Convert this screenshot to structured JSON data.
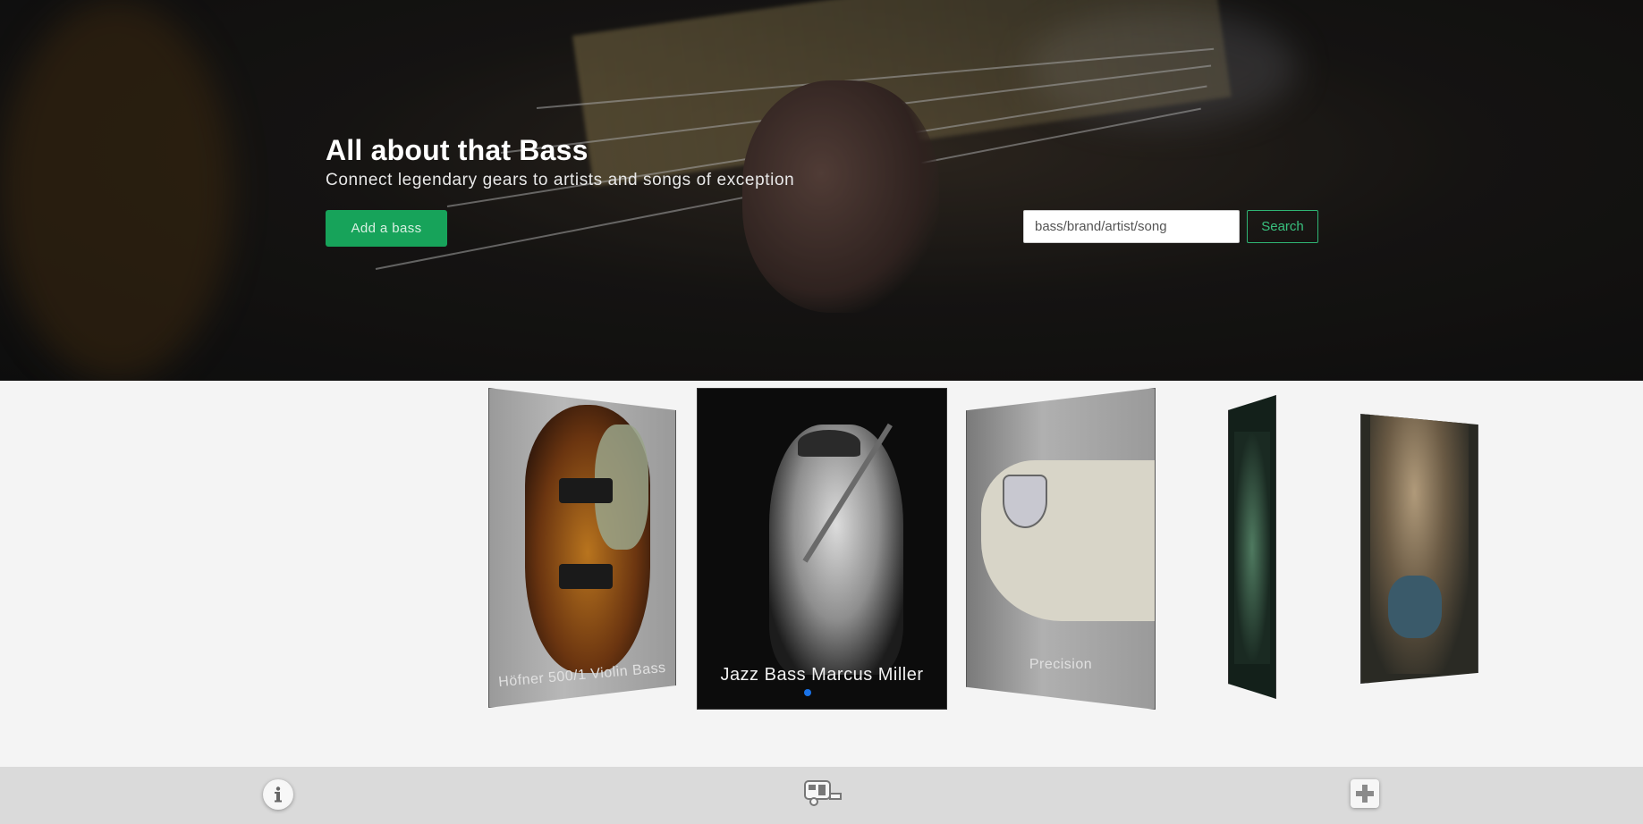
{
  "hero": {
    "title": "All about that Bass",
    "subtitle": "Connect legendary gears to artists and songs of exception",
    "add_button_label": "Add a bass",
    "search_placeholder": "bass/brand/artist/song",
    "search_button_label": "Search"
  },
  "carousel": {
    "items": [
      {
        "label": "Höfner 500/1 Violin Bass"
      },
      {
        "label": "Jazz Bass Marcus Miller"
      },
      {
        "label": "Precision"
      },
      {
        "label": ""
      },
      {
        "label": ""
      }
    ],
    "active_index": 1,
    "indicator_color": "#1a73e8"
  },
  "footer": {
    "icons": [
      "info-icon",
      "van-icon",
      "add-icon"
    ]
  },
  "colors": {
    "accent": "#17a35a",
    "search_accent": "#2fb574",
    "footer_bg": "#dadada",
    "page_bg": "#f4f4f4"
  }
}
